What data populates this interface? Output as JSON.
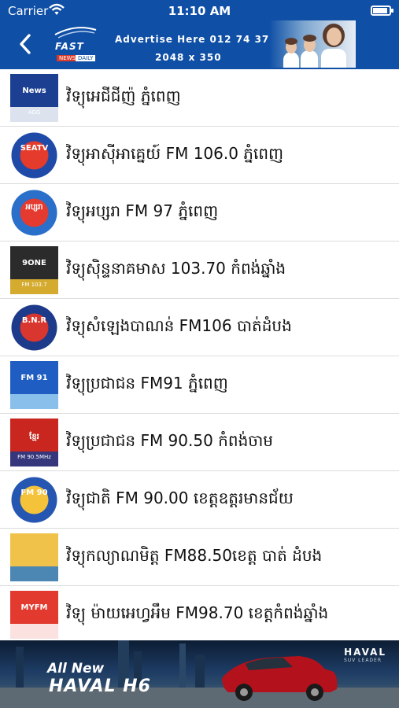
{
  "status_bar": {
    "carrier": "Carrier",
    "time": "11:10 AM"
  },
  "header": {
    "back_icon": "chevron-left-icon",
    "logo": {
      "text": "FAST",
      "tag_left": "NEWS",
      "tag_right": "DAILY"
    },
    "ad": {
      "line1": "Advertise Here 012 74 37 75",
      "line2": "2048 x 350"
    }
  },
  "stations": [
    {
      "name": "វិទ្យុអេជីជីញ៉ ភ្នំពេញ",
      "logo_text": "News",
      "logo_sub": "AGG",
      "logo_colors": [
        "#1c3f91",
        "#ffffff"
      ]
    },
    {
      "name": "វិទ្យុអាស៊ីអាគ្នេយ៍ FM 106.0  ភ្នំពេញ",
      "logo_text": "SEATV",
      "logo_sub": "",
      "logo_colors": [
        "#1f4aa8",
        "#e43b2c"
      ]
    },
    {
      "name": "វិទ្យុអប្សរា FM 97 ភ្នំពេញ",
      "logo_text": "អប្សរា",
      "logo_sub": "",
      "logo_colors": [
        "#2a6fc9",
        "#e53a30"
      ]
    },
    {
      "name": "វិទ្យុស៊ិន្ទនាគមាស 103.70 កំពង់ឆ្នាំង",
      "logo_text": "9ONE",
      "logo_sub": "FM 103.7",
      "logo_colors": [
        "#2b2b2b",
        "#f2c230"
      ]
    },
    {
      "name": "វិទ្យុសំឡេងបាណន់ FM106 បាត់ដំបង",
      "logo_text": "B.N.R",
      "logo_sub": "",
      "logo_colors": [
        "#1d3b8a",
        "#d8362e"
      ]
    },
    {
      "name": "វិទ្យុប្រជាជន FM91 ភ្នំពេញ",
      "logo_text": "FM 91",
      "logo_sub": "",
      "logo_colors": [
        "#1f5dc2",
        "#9bd0f2"
      ]
    },
    {
      "name": "វិទ្យុប្រជាជន FM 90.50 កំពង់ចាម",
      "logo_text": "ខ្មែរ",
      "logo_sub": "FM 90.5MHz",
      "logo_colors": [
        "#c8261f",
        "#1b3a8c"
      ]
    },
    {
      "name": "វិទ្យុជាតិ  FM 90.00 ខេត្តឧត្តរមានជ័យ",
      "logo_text": "FM 90",
      "logo_sub": "",
      "logo_colors": [
        "#2456b2",
        "#f4c33a"
      ]
    },
    {
      "name": "វិទ្យុកល្យាណមិត្ត FM88.50ខេត្ត បាត់ ដំបង",
      "logo_text": "",
      "logo_sub": "",
      "logo_colors": [
        "#f1c24a",
        "#2f7bc4"
      ]
    },
    {
      "name": "វិទ្យុ ម៉ាយអេហ្វអឹម FM98.70  ខេត្តកំពង់ឆ្នាំង",
      "logo_text": "MYFM",
      "logo_sub": "",
      "logo_colors": [
        "#e23a2e",
        "#ffffff"
      ]
    }
  ],
  "footer_banner": {
    "line1": "All New",
    "line2": "HAVAL H6",
    "brand": "HAVAL",
    "brand_sub": "SUV LEADER"
  },
  "colors": {
    "header_bg": "#0f4fa6",
    "divider": "#dcdcdc"
  }
}
